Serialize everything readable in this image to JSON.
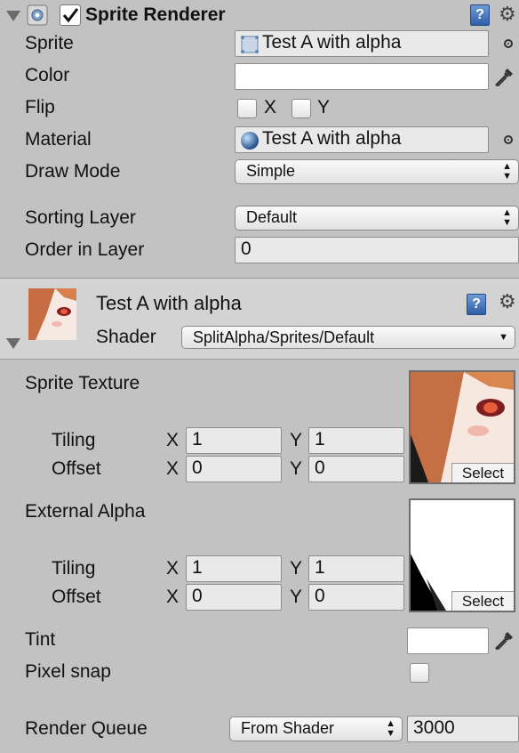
{
  "sprite_renderer": {
    "title": "Sprite Renderer",
    "enabled": true,
    "sprite": {
      "label": "Sprite",
      "value": "Test A with alpha"
    },
    "color": {
      "label": "Color",
      "value": "#ffffff"
    },
    "flip": {
      "label": "Flip",
      "x_label": "X",
      "y_label": "Y",
      "x_checked": false,
      "y_checked": false
    },
    "material": {
      "label": "Material",
      "value": "Test A with alpha"
    },
    "draw_mode": {
      "label": "Draw Mode",
      "value": "Simple"
    },
    "sorting_layer": {
      "label": "Sorting Layer",
      "value": "Default"
    },
    "order_in_layer": {
      "label": "Order in Layer",
      "value": "0"
    }
  },
  "material_section": {
    "title": "Test A with alpha",
    "shader_label": "Shader",
    "shader_value": "SplitAlpha/Sprites/Default",
    "sprite_texture": {
      "label": "Sprite Texture",
      "tiling_label": "Tiling",
      "offset_label": "Offset",
      "tiling": {
        "x": "1",
        "y": "1"
      },
      "offset": {
        "x": "0",
        "y": "0"
      },
      "select_label": "Select"
    },
    "external_alpha": {
      "label": "External Alpha",
      "tiling_label": "Tiling",
      "offset_label": "Offset",
      "tiling": {
        "x": "1",
        "y": "1"
      },
      "offset": {
        "x": "0",
        "y": "0"
      },
      "select_label": "Select"
    },
    "axis_labels": {
      "x": "X",
      "y": "Y"
    },
    "tint": {
      "label": "Tint",
      "value": "#ffffff"
    },
    "pixel_snap": {
      "label": "Pixel snap",
      "checked": false
    },
    "render_queue": {
      "label": "Render Queue",
      "mode": "From Shader",
      "value": "3000"
    }
  },
  "icons": [
    "foldout-arrow-icon",
    "sprite-renderer-icon",
    "checkbox-check-icon",
    "help-icon",
    "gear-icon",
    "object-picker-icon",
    "eyedropper-icon",
    "sphere-material-icon",
    "sprite-thumb-icon"
  ]
}
